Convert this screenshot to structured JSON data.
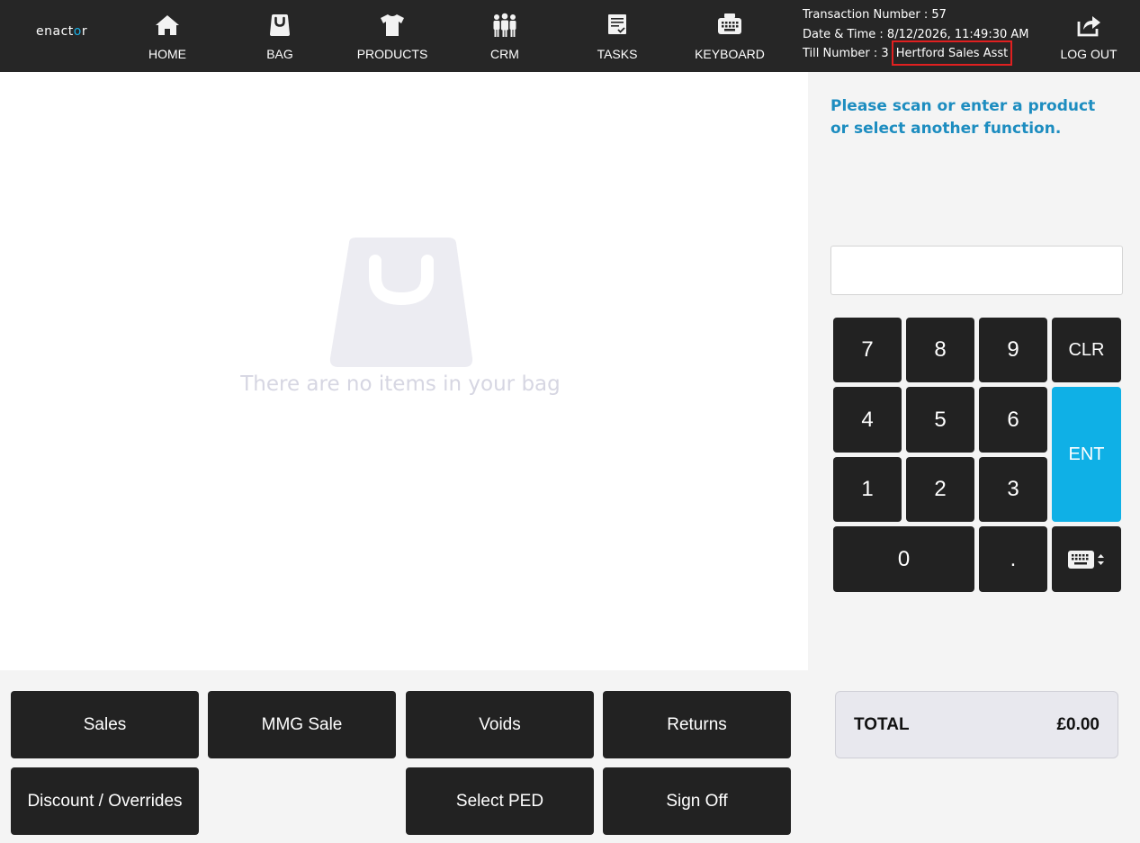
{
  "header": {
    "logo_prefix": "enact",
    "logo_accent": "o",
    "logo_suffix": "r",
    "nav": [
      {
        "label": "HOME",
        "icon": "home-icon"
      },
      {
        "label": "BAG",
        "icon": "bag-icon"
      },
      {
        "label": "PRODUCTS",
        "icon": "tshirt-icon"
      },
      {
        "label": "CRM",
        "icon": "people-icon"
      },
      {
        "label": "TASKS",
        "icon": "tasks-icon"
      },
      {
        "label": "KEYBOARD",
        "icon": "keyboard-icon"
      }
    ],
    "transaction_number": "Transaction Number : 57",
    "date_time": "Date & Time : 8/12/2026, 11:49:30 AM",
    "till_number": "Till Number : 3",
    "till_user": "Hertford Sales Asst",
    "logout_label": "LOG OUT",
    "logout_icon": "share-icon"
  },
  "bag": {
    "empty_message": "There are no items in your bag",
    "empty_icon": "shopping-bag-icon"
  },
  "panel": {
    "prompt": "Please scan or enter a product or select another function.",
    "input_value": "",
    "keys": {
      "k7": "7",
      "k8": "8",
      "k9": "9",
      "clr": "CLR",
      "k4": "4",
      "k5": "5",
      "k6": "6",
      "ent": "ENT",
      "k1": "1",
      "k2": "2",
      "k3": "3",
      "k0": "0",
      "dot": "."
    },
    "keyboard_toggle_icon": "keyboard-toggle-icon",
    "total_label": "TOTAL",
    "total_value": "£0.00"
  },
  "functions": {
    "sales": "Sales",
    "mmg_sale": "MMG Sale",
    "voids": "Voids",
    "returns": "Returns",
    "discount": "Discount / Overrides",
    "select_ped": "Select PED",
    "sign_off": "Sign Off"
  },
  "colors": {
    "topbar": "#262626",
    "accent": "#0fb0e6",
    "prompt": "#1d8dc0",
    "highlight_border": "#e02020"
  }
}
